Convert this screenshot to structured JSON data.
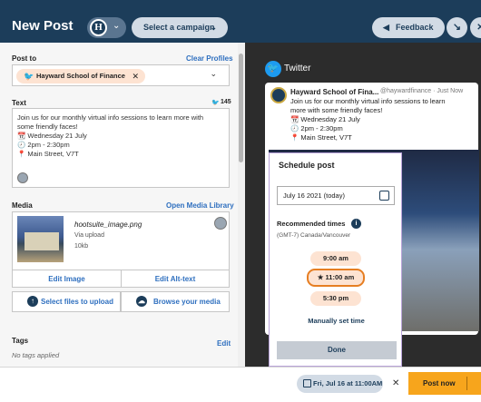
{
  "header": {
    "title": "New Post",
    "org_initial": "H",
    "campaign_label": "Select a campaign",
    "feedback_label": "Feedback"
  },
  "post_to": {
    "label": "Post to",
    "clear_label": "Clear Profiles",
    "profile_chip": "Hayward School of Finance"
  },
  "text": {
    "label": "Text",
    "char_count": "145",
    "lines": [
      "Join us for our monthly virtual info sessions to learn more with",
      "some friendly faces!",
      "📆 Wednesday 21 July",
      "🕗 2pm - 2:30pm",
      "📍 Main Street, V7T"
    ]
  },
  "media": {
    "label": "Media",
    "library_label": "Open Media Library",
    "file_name": "hootsuite_image.png",
    "file_source": "Via upload",
    "file_size": "10kb",
    "edit_image": "Edit Image",
    "edit_alt": "Edit Alt-text",
    "select_files": "Select files to upload",
    "browse_media": "Browse your media"
  },
  "tags": {
    "label": "Tags",
    "edit_label": "Edit",
    "empty_text": "No tags applied"
  },
  "preview": {
    "network": "Twitter",
    "name": "Hayward School of Fina...",
    "handle": "@haywardfinance · Just Now",
    "body": [
      "Join us for our monthly virtual info sessions to learn",
      "more with some friendly faces!",
      "📆 Wednesday 21 July",
      "🕗 2pm - 2:30pm",
      "📍 Main Street, V7T"
    ]
  },
  "schedule": {
    "title": "Schedule post",
    "date_value": "July 16  2021  (today)",
    "recommended_label": "Recommended times",
    "timezone": "(GMT-7) Canada/Vancouver",
    "times": [
      "9:00 am",
      "11:00 am",
      "5:30 pm"
    ],
    "selected_time": "11:00 am",
    "manual_label": "Manually set time",
    "done_label": "Done"
  },
  "footer": {
    "scheduled_label": "Fri, Jul 16 at 11:00AM",
    "post_now_label": "Post now"
  },
  "colors": {
    "header_bg": "#1c3d5a",
    "accent_orange": "#f7a51c",
    "chip_peach": "#fde3d2",
    "link_blue": "#2e6fbf",
    "twitter_blue": "#1d9bf0"
  }
}
